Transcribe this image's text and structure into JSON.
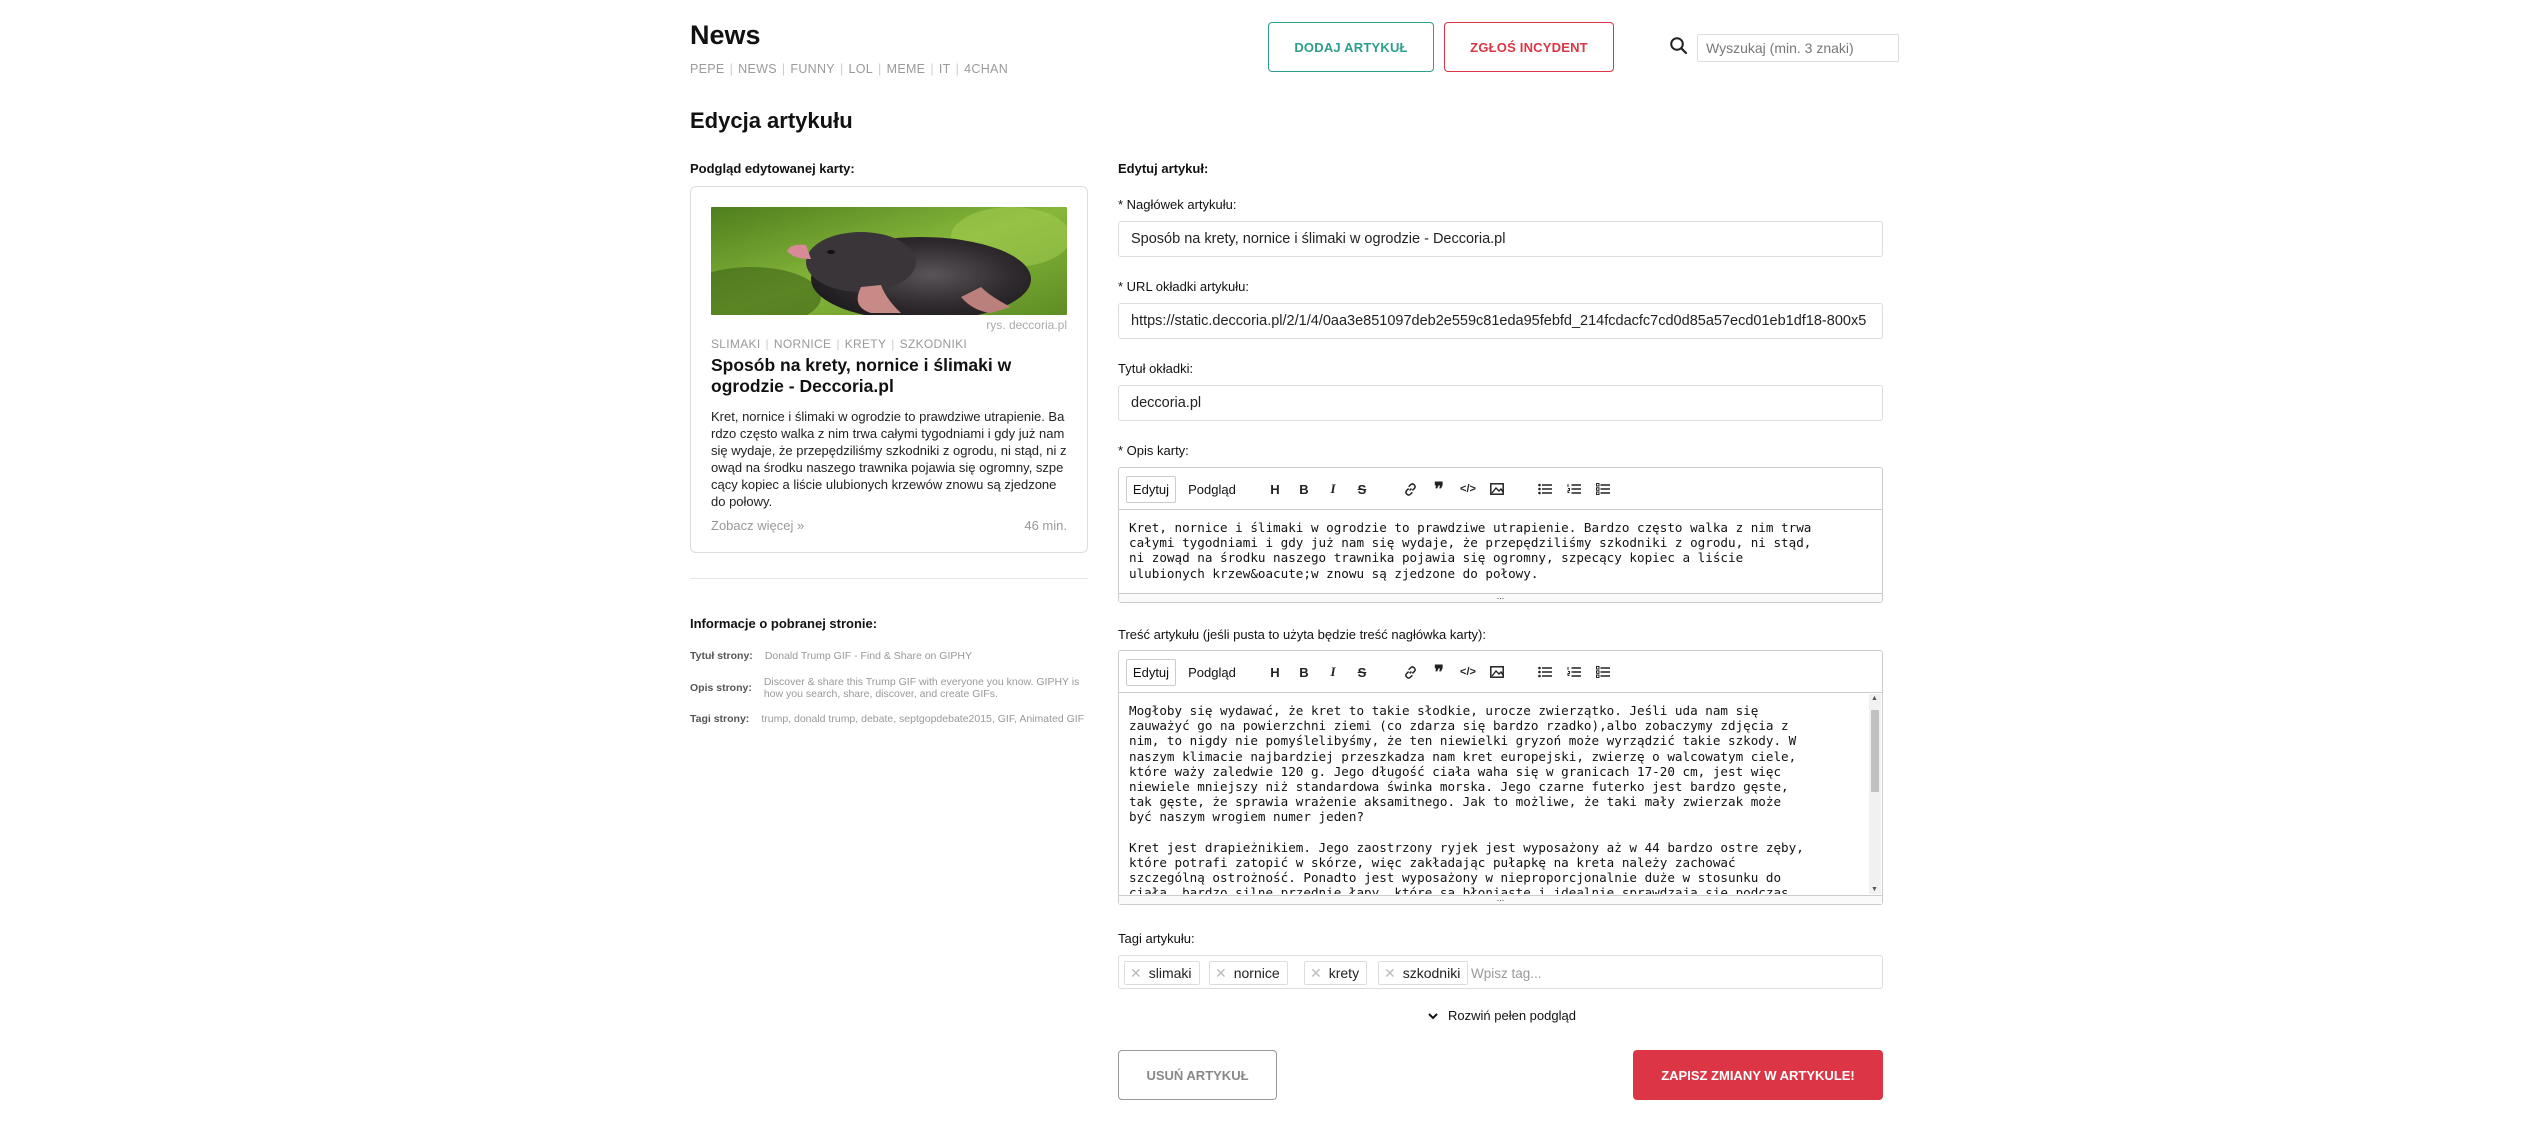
{
  "header": {
    "site_title": "News",
    "nav": [
      "PEPE",
      "NEWS",
      "FUNNY",
      "LOL",
      "MEME",
      "IT",
      "4CHAN"
    ],
    "add_article_label": "DODAJ ARTYKUŁ",
    "report_incident_label": "ZGŁOŚ INCYDENT",
    "search_placeholder": "Wyszukaj (min. 3 znaki)"
  },
  "page_title": "Edycja artykułu",
  "preview": {
    "section_label": "Podgląd edytowanej karty:",
    "image_credit": "rys. deccoria.pl",
    "tags": [
      "SLIMAKI",
      "NORNICE",
      "KRETY",
      "SZKODNIKI"
    ],
    "title": "Sposób na krety, nornice i ślimaki w ogrodzie - Deccoria.pl",
    "description": "Kret, nornice i ślimaki w ogrodzie to prawdziwe utrapienie. Bardzo często walka z nim trwa całymi tygodniami i gdy już nam się wydaje, że przepędziliśmy szkodniki z ogrodu, ni stąd, ni zowąd na środku naszego trawnika pojawia się ogromny, szpecący kopiec a liście ulubionych krzewów znowu są zjedzone do połowy.",
    "see_more": "Zobacz więcej »",
    "read_time": "46 min."
  },
  "page_info": {
    "section_label": "Informacje o pobranej stronie:",
    "title_key": "Tytuł strony:",
    "title_value": "Donald Trump GIF - Find & Share on GIPHY",
    "desc_key": "Opis strony:",
    "desc_value": "Discover & share this Trump GIF with everyone you know. GIPHY is how you search, share, discover, and create GIFs.",
    "tags_key": "Tagi strony:",
    "tags_value": "trump, donald trump, debate, septgopdebate2015, GIF, Animated GIF"
  },
  "form": {
    "section_label": "Edytuj artykuł:",
    "headline_label": "* Nagłówek artykułu:",
    "headline_value": "Sposób na krety, nornice i ślimaki w ogrodzie - Deccoria.pl",
    "cover_url_label": "* URL okładki artykułu:",
    "cover_url_value": "https://static.deccoria.pl/2/1/4/0aa3e851097deb2e559c81eda95febfd_214fcdacfc7cd0d85a57ecd01eb1df18-800x5",
    "cover_title_label": "Tytuł okładki:",
    "cover_title_value": "deccoria.pl",
    "card_desc_label": "* Opis karty:",
    "card_desc_value": "Kret, nornice i ślimaki w ogrodzie to prawdziwe utrapienie. Bardzo często walka z nim trwa\ncałymi tygodniami i gdy już nam się wydaje, że przepędziliśmy szkodniki z ogrodu, ni stąd,\nni zowąd na środku naszego trawnika pojawia się ogromny, szpecący kopiec a liście\nulubionych krzew&oacute;w znowu są zjedzone do połowy.",
    "content_label": "Treść artykułu (jeśli pusta to użyta będzie treść nagłówka karty):",
    "content_value": "Mogłoby się wydawać, że kret to takie słodkie, urocze zwierzątko. Jeśli uda nam się\nzauważyć go na powierzchni ziemi (co zdarza się bardzo rzadko),albo zobaczymy zdjęcia z\nnim, to nigdy nie pomyślelibyśmy, że ten niewielki gryzoń może wyrządzić takie szkody. W\nnaszym klimacie najbardziej przeszkadza nam kret europejski, zwierzę o walcowatym ciele,\nktóre waży zaledwie 120 g. Jego długość ciała waha się w granicach 17-20 cm, jest więc\nniewiele mniejszy niż standardowa świnka morska. Jego czarne futerko jest bardzo gęste,\ntak gęste, że sprawia wrażenie aksamitnego. Jak to możliwe, że taki mały zwierzak może\nbyć naszym wrogiem numer jeden?\n\nKret jest drapieżnikiem. Jego zaostrzony ryjek jest wyposażony aż w 44 bardzo ostre zęby,\nktóre potrafi zatopić w skórze, więc zakładając pułapkę na kreta należy zachować\nszczególną ostrożność. Ponadto jest wyposażony w nieproporcjonalnie duże w stosunku do\nciała, bardzo silne przednie łapy, które są błoniaste i idealnie sprawdzają się podczas",
    "editor_tab_edit": "Edytuj",
    "editor_tab_preview": "Podgląd",
    "tags_label": "Tagi artykułu:",
    "tags": [
      "slimaki",
      "nornice",
      "krety",
      "szkodniki"
    ],
    "tag_placeholder": "Wpisz tag...",
    "expand_label": "Rozwiń pełen podgląd",
    "delete_label": "USUŃ ARTYKUŁ",
    "save_label": "ZAPISZ ZMIANY W ARTYKULE!"
  },
  "colors": {
    "teal_accent": "#2c9e8c",
    "red_accent": "#dc3545"
  },
  "toolbar_icons": [
    "heading-icon",
    "bold-icon",
    "italic-icon",
    "strikethrough-icon",
    "link-icon",
    "quote-icon",
    "code-icon",
    "image-icon",
    "bulleted-list-icon",
    "numbered-list-icon",
    "task-list-icon"
  ]
}
